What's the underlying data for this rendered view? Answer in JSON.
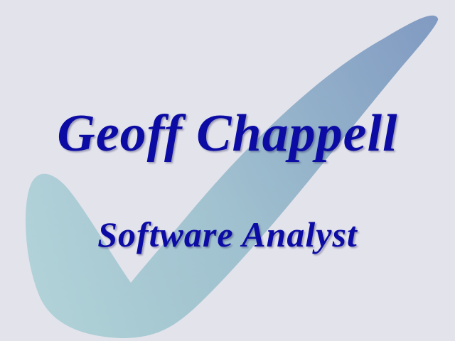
{
  "heading": {
    "name": "Geoff Chappell",
    "role": "Software Analyst"
  },
  "colors": {
    "background": "#e3e3eb",
    "text": "#0c0ca4",
    "swoosh_light": "#a9d3d6",
    "swoosh_dark": "#7f9cc2"
  },
  "graphic": {
    "icon": "checkmark-swoosh-icon"
  }
}
